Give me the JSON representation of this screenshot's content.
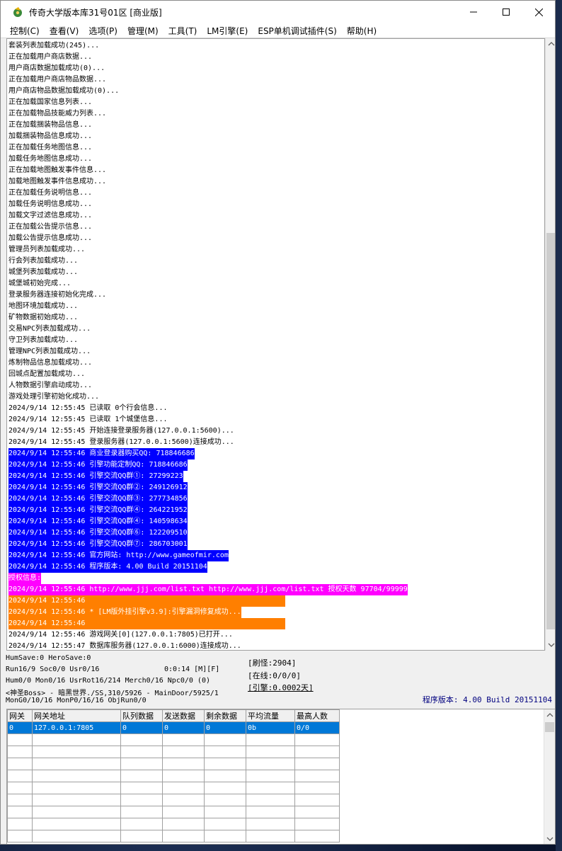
{
  "window": {
    "title": "传奇大学版本库31号01区 [商业版]"
  },
  "menu": [
    "控制(C)",
    "查看(V)",
    "选项(P)",
    "管理(M)",
    "工具(T)",
    "LM引擎(E)",
    "ESP单机调试插件(S)",
    "帮助(H)"
  ],
  "log": [
    {
      "text": "套装列表加载成功(245)...",
      "style": ""
    },
    {
      "text": "正在加载用户商店数据...",
      "style": ""
    },
    {
      "text": "用户商店数据加载成功(0)...",
      "style": ""
    },
    {
      "text": "正在加载用户商店物品数据...",
      "style": ""
    },
    {
      "text": "用户商店物品数据加载成功(0)...",
      "style": ""
    },
    {
      "text": "正在加载国家信息列表...",
      "style": ""
    },
    {
      "text": "正在加载物品技能威力列表...",
      "style": ""
    },
    {
      "text": "正在加载捆装物品信息...",
      "style": ""
    },
    {
      "text": "加载捆装物品信息成功...",
      "style": ""
    },
    {
      "text": "正在加载任务地图信息...",
      "style": ""
    },
    {
      "text": "加载任务地图信息成功...",
      "style": ""
    },
    {
      "text": "正在加载地图触发事件信息...",
      "style": ""
    },
    {
      "text": "加载地图触发事件信息成功...",
      "style": ""
    },
    {
      "text": "正在加载任务说明信息...",
      "style": ""
    },
    {
      "text": "加载任务说明信息成功...",
      "style": ""
    },
    {
      "text": "加载文字过滤信息成功...",
      "style": ""
    },
    {
      "text": "正在加载公告提示信息...",
      "style": ""
    },
    {
      "text": "加载公告提示信息成功...",
      "style": ""
    },
    {
      "text": "管理员列表加载成功...",
      "style": ""
    },
    {
      "text": "行会列表加载成功...",
      "style": ""
    },
    {
      "text": "城堡列表加载成功...",
      "style": ""
    },
    {
      "text": "城堡城初始完成...",
      "style": ""
    },
    {
      "text": "登录服务器连接初始化完成...",
      "style": ""
    },
    {
      "text": "地图环境加载成功...",
      "style": ""
    },
    {
      "text": "矿物数据初始成功...",
      "style": ""
    },
    {
      "text": "交易NPC列表加载成功...",
      "style": ""
    },
    {
      "text": "守卫列表加载成功...",
      "style": ""
    },
    {
      "text": "管理NPC列表加载成功...",
      "style": ""
    },
    {
      "text": "炼制物品信息加载成功...",
      "style": ""
    },
    {
      "text": "回城点配置加载成功...",
      "style": ""
    },
    {
      "text": "人物数据引擎启动成功...",
      "style": ""
    },
    {
      "text": "游戏处理引擎初始化成功...",
      "style": ""
    },
    {
      "text": "2024/9/14 12:55:45 已读取 0个行会信息...",
      "style": ""
    },
    {
      "text": "2024/9/14 12:55:45 已读取 1个城堡信息...",
      "style": ""
    },
    {
      "text": "2024/9/14 12:55:45 开始连接登录服务器(127.0.0.1:5600)...",
      "style": ""
    },
    {
      "text": "2024/9/14 12:55:45 登录服务器(127.0.0.1:5600)连接成功...",
      "style": ""
    },
    {
      "text": "2024/9/14 12:55:46 商业登录器购买QQ: 718846686",
      "style": "blue"
    },
    {
      "text": "2024/9/14 12:55:46 引擎功能定制QQ: 718846686",
      "style": "blue"
    },
    {
      "text": "2024/9/14 12:55:46 引擎交流QQ群①: 27299223",
      "style": "blue"
    },
    {
      "text": "2024/9/14 12:55:46 引擎交流QQ群②: 249126912",
      "style": "blue"
    },
    {
      "text": "2024/9/14 12:55:46 引擎交流QQ群③: 277734856",
      "style": "blue"
    },
    {
      "text": "2024/9/14 12:55:46 引擎交流QQ群④: 264221952",
      "style": "blue"
    },
    {
      "text": "2024/9/14 12:55:46 引擎交流QQ群④: 140598634",
      "style": "blue"
    },
    {
      "text": "2024/9/14 12:55:46 引擎交流QQ群⑥: 122209510",
      "style": "blue"
    },
    {
      "text": "2024/9/14 12:55:46 引擎交流QQ群⑦: 286703001",
      "style": "blue"
    },
    {
      "text": "2024/9/14 12:55:46 官方网站: http://www.gameofmir.com",
      "style": "blue"
    },
    {
      "text": "2024/9/14 12:55:46 程序版本: 4.00 Build 20151104",
      "style": "blue"
    },
    {
      "text": "授权信息:",
      "style": "magenta"
    },
    {
      "text": "2024/9/14 12:55:46 http://www.jjj.com/list.txt http://www.jjj.com/list.txt 授权天数 97704/99999",
      "style": "magenta"
    },
    {
      "text": "2024/9/14 12:55:46",
      "style": "orange-line"
    },
    {
      "text": "2024/9/14 12:55:46 * [LM版外挂引擎v3.9]:引擎漏洞修复成功...",
      "style": "orange"
    },
    {
      "text": "2024/9/14 12:55:46",
      "style": "orange-line"
    },
    {
      "text": "2024/9/14 12:55:46 游戏网关[0](127.0.0.1:7805)已打开...",
      "style": ""
    },
    {
      "text": "2024/9/14 12:55:47 数据库服务器(127.0.0.1:6000)连接成功...",
      "style": ""
    }
  ],
  "status": {
    "line1": "HumSave:0 HeroSave:0",
    "line2a": "Run16/9 Soc0/0 Usr0/16",
    "line2b": "0:0:14 [M][F]",
    "line3": "Hum0/0 Mon0/16 UsrRot16/214 Merch0/16 Npc0/0 (0)",
    "line4": "<神圣Boss> - 暗黑世界./SS,310/5926 - MainDoor/5925/1",
    "line5": "MonG0/10/16 MonP0/16/16 ObjRun0/0",
    "refresh": "[刷怪:2904]",
    "online": "[在线:0/0/0]",
    "engine": "[引擎:0.0002天]",
    "version": "程序版本: 4.00 Build 20151104"
  },
  "gateway_table": {
    "headers": [
      "网关",
      "网关地址",
      "队列数据",
      "发送数据",
      "剩余数据",
      "平均流量",
      "最高人数"
    ],
    "rows": [
      [
        "0",
        "127.0.0.1:7805",
        "0",
        "0",
        "0",
        "0b",
        "0/0"
      ]
    ]
  }
}
